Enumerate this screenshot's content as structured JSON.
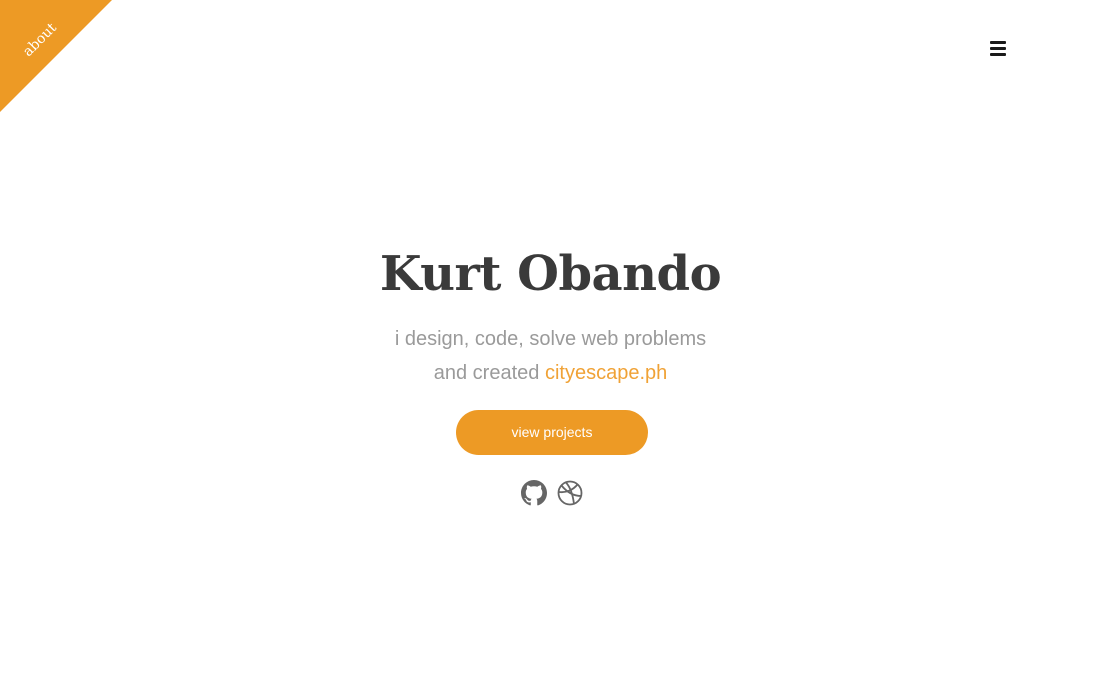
{
  "ribbon": {
    "label": "about",
    "color": "#ed9a25"
  },
  "menu": {
    "icon": "hamburger-menu-icon"
  },
  "hero": {
    "name": "Kurt Obando",
    "line1": "i design, code, solve web problems",
    "line2_prefix": "and created",
    "line2_link": "cityescape.ph",
    "cta_label": "view projects"
  },
  "social": [
    {
      "icon": "github-icon"
    },
    {
      "icon": "dribbble-icon"
    }
  ],
  "colors": {
    "accent": "#ed9a25",
    "link": "#f0a236",
    "title": "#3a3a3a",
    "subtitle": "#9a9a9a"
  }
}
